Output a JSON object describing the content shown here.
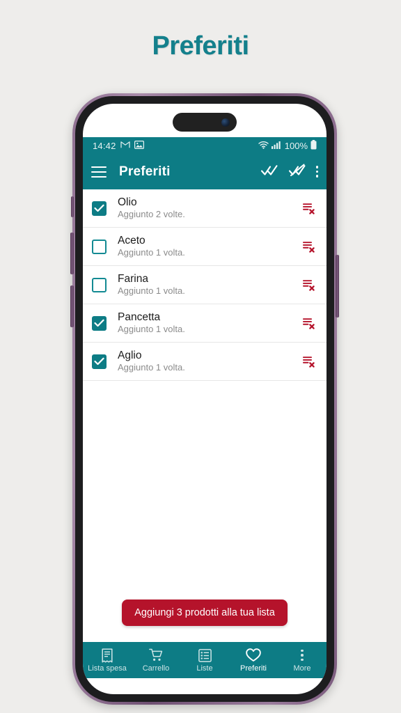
{
  "page": {
    "title": "Preferiti",
    "background_color": "#eeedeb",
    "title_color": "#14808c"
  },
  "theme": {
    "teal": "#0d7c85",
    "red": "#b5132b",
    "remove_icon_red": "#b5132b",
    "frame_purple": "#7b5b7d"
  },
  "statusbar": {
    "time": "14:42",
    "icons_left": [
      "gmail-icon",
      "photos-icon"
    ],
    "wifi": "wifi-icon",
    "signal": "cellular-signal-icon",
    "battery_percent": "100%",
    "battery": "battery-full-icon"
  },
  "appbar": {
    "menu_icon": "hamburger-menu-icon",
    "title": "Preferiti",
    "select_all_icon": "double-check-icon",
    "deselect_all_icon": "double-check-crossed-icon",
    "overflow_icon": "more-vertical-icon"
  },
  "list": {
    "items": [
      {
        "name": "Olio",
        "subtitle": "Aggiunto 2 volte.",
        "checked": true
      },
      {
        "name": "Aceto",
        "subtitle": "Aggiunto 1 volta.",
        "checked": false
      },
      {
        "name": "Farina",
        "subtitle": "Aggiunto 1 volta.",
        "checked": false
      },
      {
        "name": "Pancetta",
        "subtitle": "Aggiunto 1 volta.",
        "checked": true
      },
      {
        "name": "Aglio",
        "subtitle": "Aggiunto 1 volta.",
        "checked": true
      }
    ],
    "remove_icon": "remove-from-list-icon"
  },
  "cta": {
    "label": "Aggiungi 3 prodotti alla tua lista"
  },
  "bottomnav": {
    "items": [
      {
        "label": "Lista spesa",
        "icon": "receipt-icon",
        "active": false
      },
      {
        "label": "Carrello",
        "icon": "shopping-cart-icon",
        "active": false
      },
      {
        "label": "Liste",
        "icon": "list-box-icon",
        "active": false
      },
      {
        "label": "Preferiti",
        "icon": "heart-icon",
        "active": true
      },
      {
        "label": "More",
        "icon": "more-vertical-icon",
        "active": false
      }
    ]
  }
}
